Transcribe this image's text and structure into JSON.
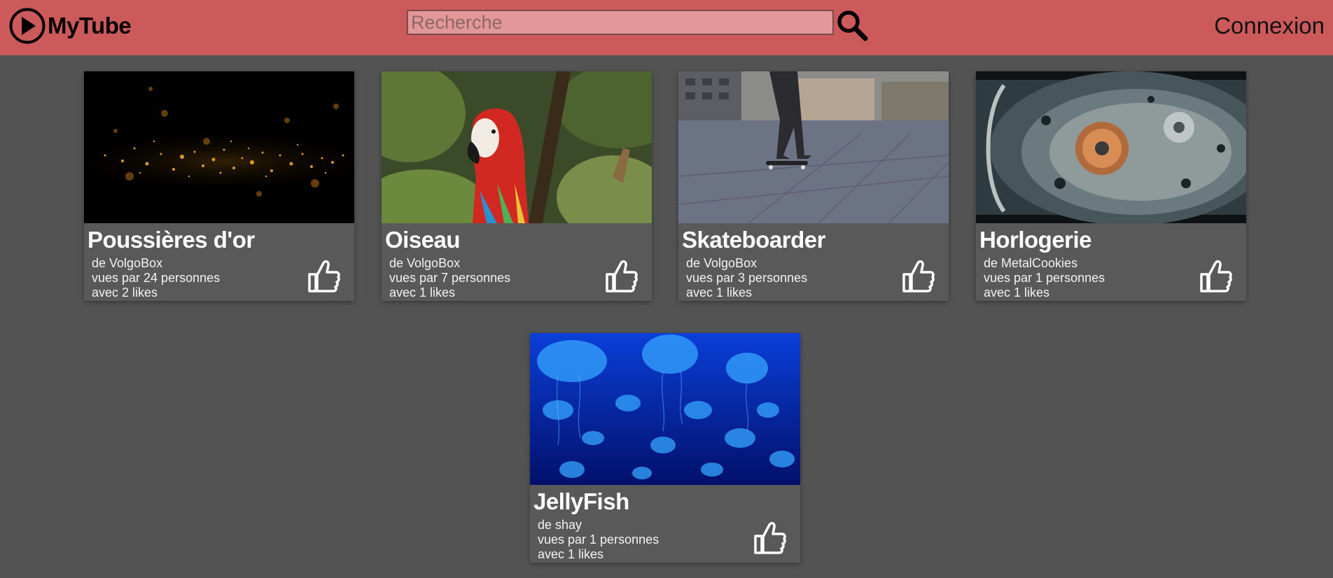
{
  "header": {
    "brand": "MyTube",
    "search_placeholder": "Recherche",
    "search_value": "",
    "login_label": "Connexion"
  },
  "colors": {
    "header_bg": "#cd5a5a",
    "page_bg": "#535353",
    "card_bg": "#595959"
  },
  "videos": [
    {
      "title": "Poussières d'or",
      "author": "de VolgoBox",
      "views": "vues par 24 personnes",
      "likes": "avec 2 likes",
      "thumbnail": "gold-dust"
    },
    {
      "title": "Oiseau",
      "author": "de VolgoBox",
      "views": "vues par 7 personnes",
      "likes": "avec 1 likes",
      "thumbnail": "parrot"
    },
    {
      "title": "Skateboarder",
      "author": "de VolgoBox",
      "views": "vues par 3 personnes",
      "likes": "avec 1 likes",
      "thumbnail": "skateboarder"
    },
    {
      "title": "Horlogerie",
      "author": "de MetalCookies",
      "views": "vues par 1 personnes",
      "likes": "avec 1 likes",
      "thumbnail": "watch-movement"
    },
    {
      "title": "JellyFish",
      "author": "de shay",
      "views": "vues par 1 personnes",
      "likes": "avec 1 likes",
      "thumbnail": "jellyfish"
    }
  ]
}
